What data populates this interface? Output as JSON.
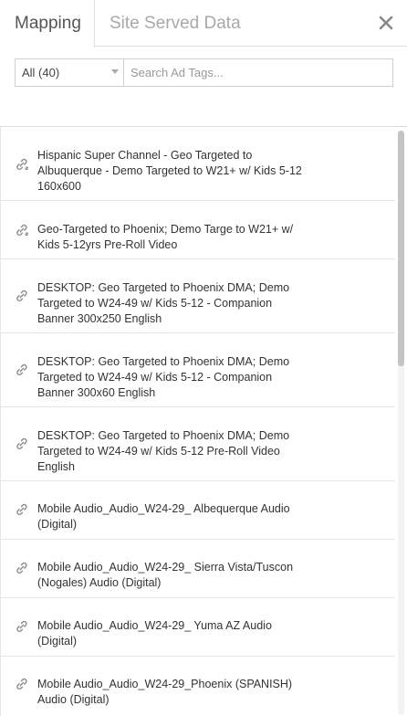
{
  "tabs": {
    "mapping": "Mapping",
    "site_served": "Site Served Data"
  },
  "filter": {
    "selected": "All (40)",
    "search_placeholder": "Search Ad Tags..."
  },
  "items": [
    {
      "label": "Hispanic Super Channel - Geo Targeted to Albuquerque - Demo Targeted to W21+ w/ Kids 5-12 160x600",
      "icon": "linked-icon"
    },
    {
      "label": "Geo-Targeted to Phoenix; Demo Targe to W21+ w/ Kids 5-12yrs Pre-Roll Video",
      "icon": "linked-icon"
    },
    {
      "label": "DESKTOP: Geo Targeted to Phoenix DMA; Demo Targeted to W24-49 w/ Kids 5-12 - Companion Banner 300x250 English",
      "icon": "link-icon"
    },
    {
      "label": "DESKTOP: Geo Targeted to Phoenix DMA; Demo Targeted to W24-49 w/ Kids 5-12 - Companion Banner 300x60 English",
      "icon": "link-icon"
    },
    {
      "label": "DESKTOP: Geo Targeted to Phoenix DMA; Demo Targeted to W24-49 w/ Kids 5-12 Pre-Roll Video English",
      "icon": "link-icon"
    },
    {
      "label": "Mobile Audio_Audio_W24-29_ Albequerque Audio (Digital)",
      "icon": "link-icon"
    },
    {
      "label": "Mobile Audio_Audio_W24-29_ Sierra Vista/Tuscon (Nogales) Audio (Digital)",
      "icon": "link-icon"
    },
    {
      "label": "Mobile Audio_Audio_W24-29_ Yuma AZ Audio (Digital)",
      "icon": "link-icon"
    },
    {
      "label": "Mobile Audio_Audio_W24-29_Phoenix (SPANISH) Audio (Digital)",
      "icon": "link-icon"
    }
  ]
}
